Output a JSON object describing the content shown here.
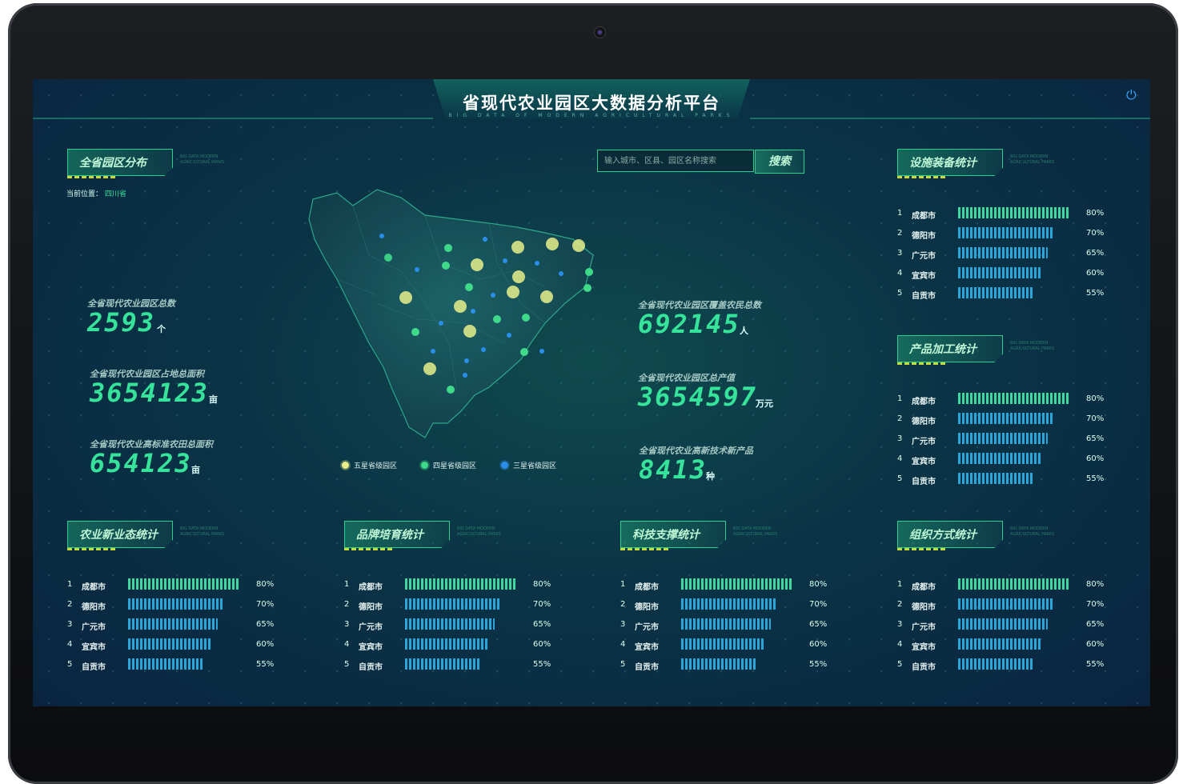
{
  "header": {
    "title": "省现代农业园区大数据分析平台",
    "subtitle": "BIG DATA OF MODERN AGRICULTURAL PARKS"
  },
  "panel_sub": "BIG DATA MODERN AGRICULTURAL PARKS",
  "left": {
    "panel_title": "全省园区分布",
    "location_label": "当前位置：",
    "location_value": "四川省",
    "stats": [
      {
        "label": "全省现代农业园区总数",
        "value": "2593",
        "unit": "个"
      },
      {
        "label": "全省现代农业园区占地总面积",
        "value": "3654123",
        "unit": "亩"
      },
      {
        "label": "全省现代农业高标准农田总面积",
        "value": "654123",
        "unit": "亩"
      }
    ]
  },
  "search": {
    "placeholder": "输入城市、区县、园区名称搜索",
    "button": "搜索"
  },
  "center_stats": [
    {
      "label": "全省现代农业园区覆盖农民总数",
      "value": "692145",
      "unit": "人"
    },
    {
      "label": "全省现代农业园区总产值",
      "value": "3654597",
      "unit": "万元"
    },
    {
      "label": "全省现代农业高新技术新产品",
      "value": "8413",
      "unit": "种"
    }
  ],
  "legend": [
    {
      "label": "五星省级园区",
      "color": "#e8f08a"
    },
    {
      "label": "四星省级园区",
      "color": "#3fd98a"
    },
    {
      "label": "三星省级园区",
      "color": "#2a8ee8"
    }
  ],
  "rankings": {
    "facility": {
      "title": "设施装备统计",
      "rows": [
        {
          "n": "1",
          "city": "成都市",
          "pct": "80%",
          "v": 0.8
        },
        {
          "n": "2",
          "city": "德阳市",
          "pct": "70%",
          "v": 0.7
        },
        {
          "n": "3",
          "city": "广元市",
          "pct": "65%",
          "v": 0.65
        },
        {
          "n": "4",
          "city": "宜宾市",
          "pct": "60%",
          "v": 0.6
        },
        {
          "n": "5",
          "city": "自贡市",
          "pct": "55%",
          "v": 0.55
        }
      ]
    },
    "processing": {
      "title": "产品加工统计",
      "rows": [
        {
          "n": "1",
          "city": "成都市",
          "pct": "80%",
          "v": 0.8
        },
        {
          "n": "2",
          "city": "德阳市",
          "pct": "70%",
          "v": 0.7
        },
        {
          "n": "3",
          "city": "广元市",
          "pct": "65%",
          "v": 0.65
        },
        {
          "n": "4",
          "city": "宜宾市",
          "pct": "60%",
          "v": 0.6
        },
        {
          "n": "5",
          "city": "自贡市",
          "pct": "55%",
          "v": 0.55
        }
      ]
    },
    "newbiz": {
      "title": "农业新业态统计",
      "rows": [
        {
          "n": "1",
          "city": "成都市",
          "pct": "80%",
          "v": 0.8
        },
        {
          "n": "2",
          "city": "德阳市",
          "pct": "70%",
          "v": 0.7
        },
        {
          "n": "3",
          "city": "广元市",
          "pct": "65%",
          "v": 0.65
        },
        {
          "n": "4",
          "city": "宜宾市",
          "pct": "60%",
          "v": 0.6
        },
        {
          "n": "5",
          "city": "自贡市",
          "pct": "55%",
          "v": 0.55
        }
      ]
    },
    "brand": {
      "title": "品牌培育统计",
      "rows": [
        {
          "n": "1",
          "city": "成都市",
          "pct": "80%",
          "v": 0.8
        },
        {
          "n": "2",
          "city": "德阳市",
          "pct": "70%",
          "v": 0.7
        },
        {
          "n": "3",
          "city": "广元市",
          "pct": "65%",
          "v": 0.65
        },
        {
          "n": "4",
          "city": "宜宾市",
          "pct": "60%",
          "v": 0.6
        },
        {
          "n": "5",
          "city": "自贡市",
          "pct": "55%",
          "v": 0.55
        }
      ]
    },
    "tech": {
      "title": "科技支撑统计",
      "rows": [
        {
          "n": "1",
          "city": "成都市",
          "pct": "80%",
          "v": 0.8
        },
        {
          "n": "2",
          "city": "德阳市",
          "pct": "70%",
          "v": 0.7
        },
        {
          "n": "3",
          "city": "广元市",
          "pct": "65%",
          "v": 0.65
        },
        {
          "n": "4",
          "city": "宜宾市",
          "pct": "60%",
          "v": 0.6
        },
        {
          "n": "5",
          "city": "自贡市",
          "pct": "55%",
          "v": 0.55
        }
      ]
    },
    "org": {
      "title": "组织方式统计",
      "rows": [
        {
          "n": "1",
          "city": "成都市",
          "pct": "80%",
          "v": 0.8
        },
        {
          "n": "2",
          "city": "德阳市",
          "pct": "70%",
          "v": 0.7
        },
        {
          "n": "3",
          "city": "广元市",
          "pct": "65%",
          "v": 0.65
        },
        {
          "n": "4",
          "city": "宜宾市",
          "pct": "60%",
          "v": 0.6
        },
        {
          "n": "5",
          "city": "自贡市",
          "pct": "55%",
          "v": 0.55
        }
      ]
    }
  }
}
